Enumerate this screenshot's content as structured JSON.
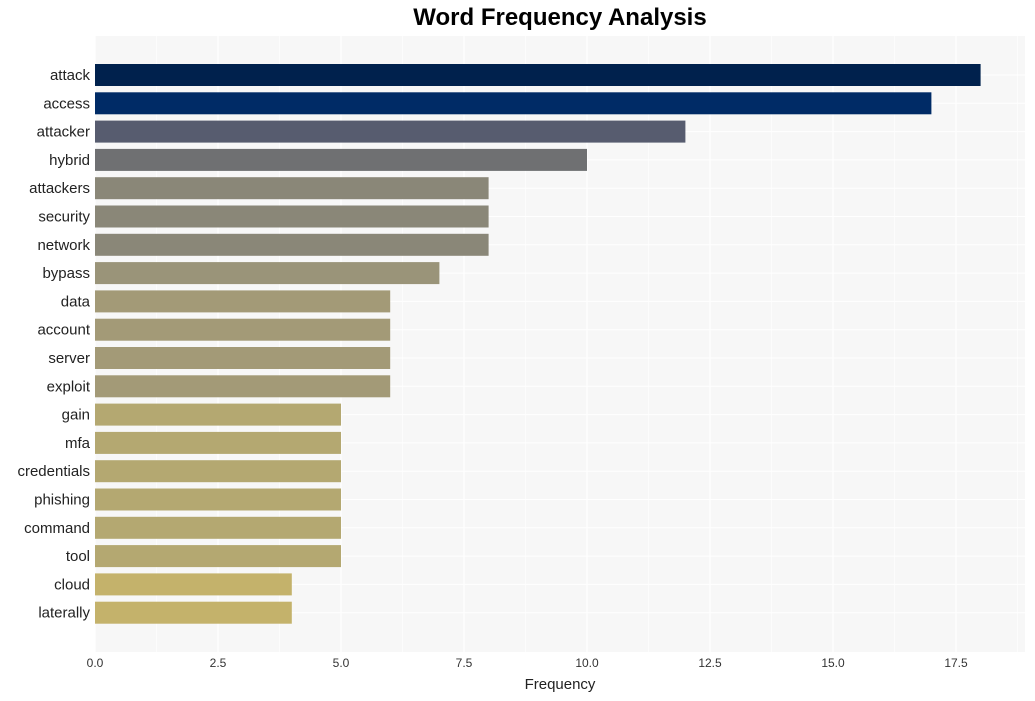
{
  "chart_data": {
    "type": "bar",
    "orientation": "horizontal",
    "title": "Word Frequency Analysis",
    "xlabel": "Frequency",
    "ylabel": "",
    "xlim": [
      0,
      18.9
    ],
    "xticks": [
      0.0,
      2.5,
      5.0,
      7.5,
      10.0,
      12.5,
      15.0,
      17.5
    ],
    "xtick_labels": [
      "0.0",
      "2.5",
      "5.0",
      "7.5",
      "10.0",
      "12.5",
      "15.0",
      "17.5"
    ],
    "grid": true,
    "legend": "none",
    "categories": [
      "attack",
      "access",
      "attacker",
      "hybrid",
      "attackers",
      "security",
      "network",
      "bypass",
      "data",
      "account",
      "server",
      "exploit",
      "gain",
      "mfa",
      "credentials",
      "phishing",
      "command",
      "tool",
      "cloud",
      "laterally"
    ],
    "values": [
      18,
      17,
      12,
      10,
      8,
      8,
      8,
      7,
      6,
      6,
      6,
      6,
      5,
      5,
      5,
      5,
      5,
      5,
      4,
      4
    ],
    "colors": [
      "#00214d",
      "#002b66",
      "#575c6f",
      "#6f7072",
      "#8a8778",
      "#8a8778",
      "#8a8778",
      "#9a9479",
      "#a39a77",
      "#a39a77",
      "#a39a77",
      "#a39a77",
      "#b4a871",
      "#b4a871",
      "#b4a871",
      "#b4a871",
      "#b4a871",
      "#b4a871",
      "#c4b26b",
      "#c4b26b"
    ]
  }
}
